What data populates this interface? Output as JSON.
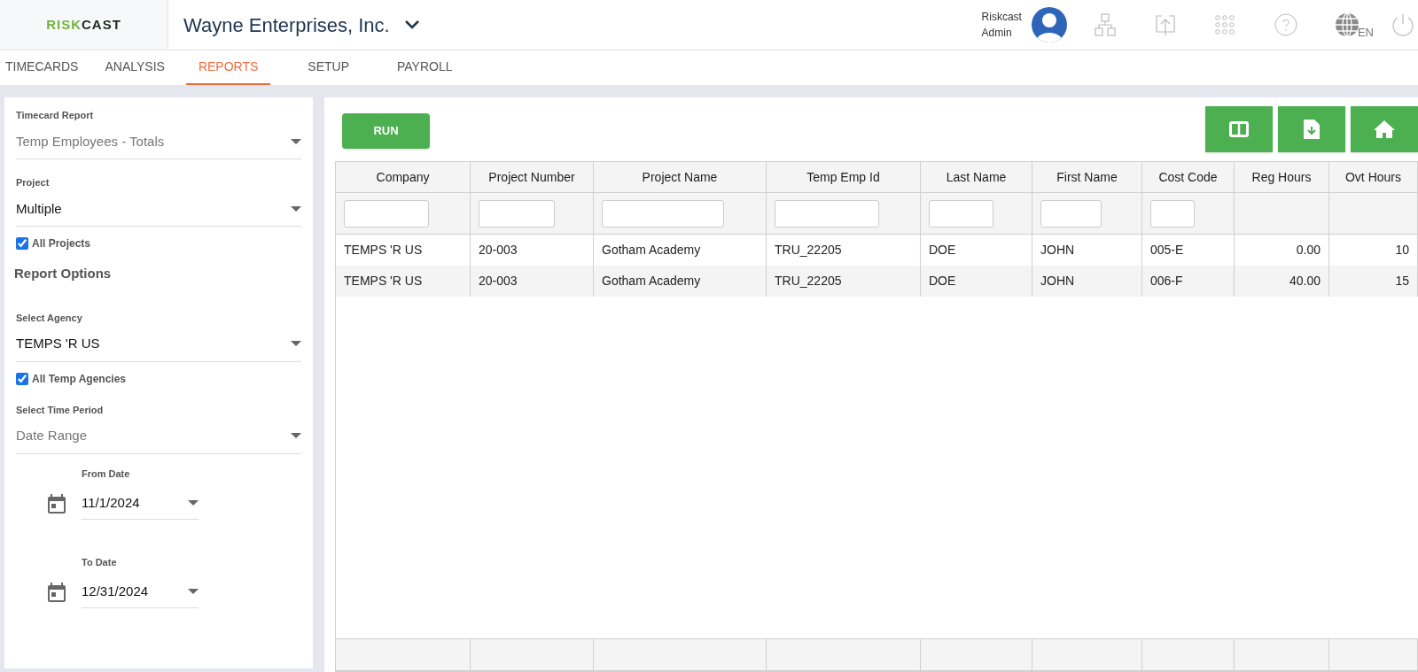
{
  "header": {
    "logo": {
      "part_1": "RISK",
      "part_2": "CAST"
    },
    "company": "Wayne Enterprises, Inc.",
    "user": {
      "line_1": "Riskcast",
      "line_2": "Admin"
    },
    "language": "EN"
  },
  "tabs": [
    {
      "label": "TIMECARDS",
      "selected": false
    },
    {
      "label": "ANALYSIS",
      "selected": false
    },
    {
      "label": "REPORTS",
      "selected": true
    },
    {
      "label": "SETUP",
      "selected": false
    },
    {
      "label": "PAYROLL",
      "selected": false
    }
  ],
  "sidebar": {
    "timecard_report": {
      "label": "Timecard Report",
      "value": "Temp Employees - Totals",
      "muted": true
    },
    "project": {
      "label": "Project",
      "value": "Multiple",
      "muted": false
    },
    "all_projects": {
      "label": "All Projects",
      "checked": true
    },
    "section_title": "Report Options",
    "agency": {
      "label": "Select Agency",
      "value": "TEMPS 'R US",
      "muted": false
    },
    "all_agencies": {
      "label": "All Temp Agencies",
      "checked": true
    },
    "time_period": {
      "label": "Select Time Period",
      "value": "Date Range",
      "muted": true
    },
    "from_date": {
      "label": "From Date",
      "value": "11/1/2024"
    },
    "to_date": {
      "label": "To Date",
      "value": "12/31/2024"
    }
  },
  "run_button": "RUN",
  "table": {
    "columns": [
      {
        "label": "Company",
        "filter": true,
        "kind": "text"
      },
      {
        "label": "Project Number",
        "filter": true,
        "kind": "text"
      },
      {
        "label": "Project Name",
        "filter": true,
        "kind": "text"
      },
      {
        "label": "Temp Emp Id",
        "filter": true,
        "kind": "text"
      },
      {
        "label": "Last Name",
        "filter": true,
        "kind": "text"
      },
      {
        "label": "First Name",
        "filter": true,
        "kind": "text"
      },
      {
        "label": "Cost Code",
        "filter": true,
        "kind": "text"
      },
      {
        "label": "Reg Hours",
        "filter": false,
        "kind": "number"
      },
      {
        "label": "Ovt Hours",
        "filter": false,
        "kind": "number"
      }
    ],
    "rows": [
      [
        "TEMPS 'R US",
        "20-003",
        "Gotham Academy",
        "TRU_22205",
        "DOE",
        "JOHN",
        "005-E",
        "0.00",
        "10"
      ],
      [
        "TEMPS 'R US",
        "20-003",
        "Gotham Academy",
        "TRU_22205",
        "DOE",
        "JOHN",
        "006-F",
        "40.00",
        "15"
      ]
    ]
  }
}
